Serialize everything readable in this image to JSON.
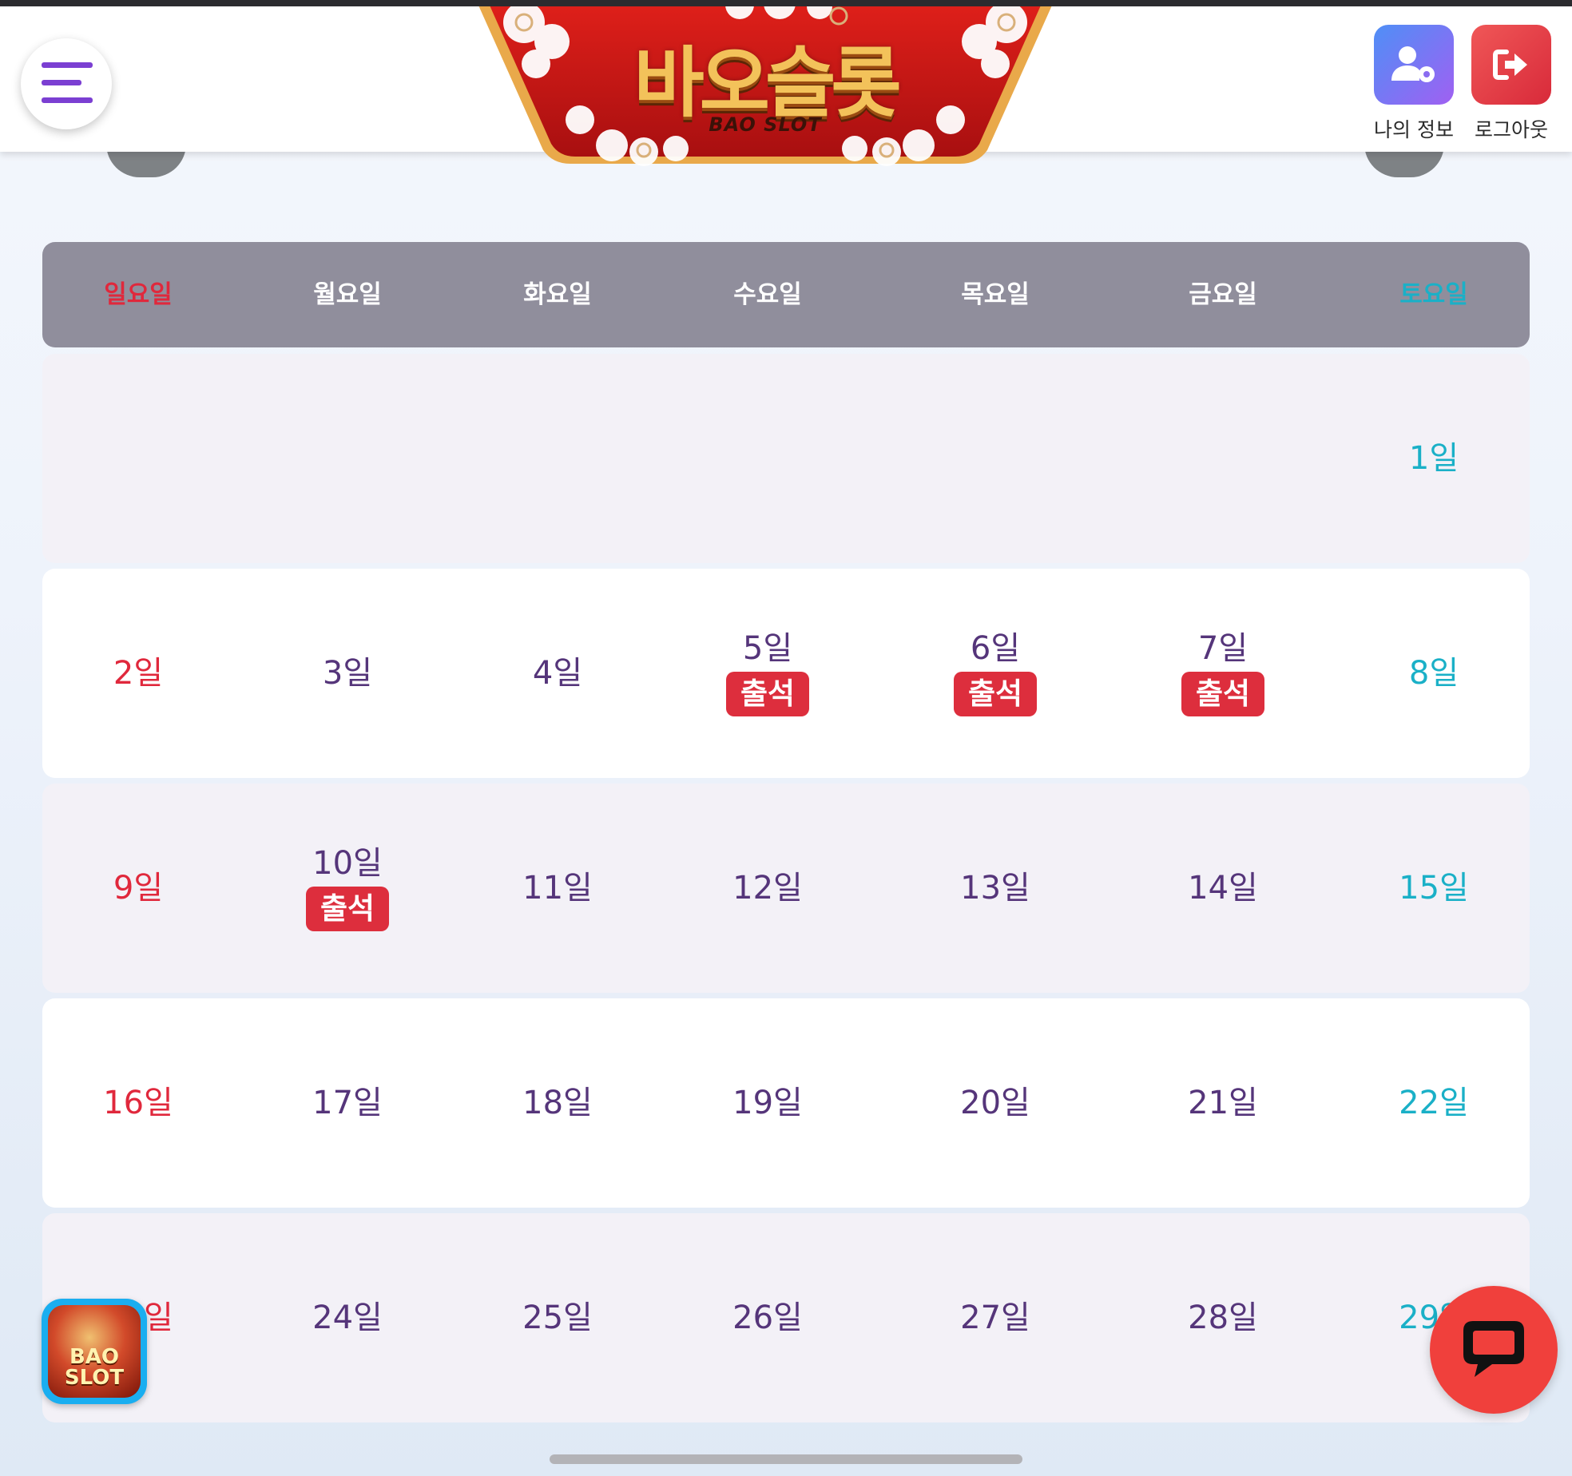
{
  "header": {
    "logo_title": "바오슬롯",
    "logo_subtitle": "BAO SLOT",
    "menu_icon": "hamburger-icon",
    "actions": [
      {
        "label": "나의 정보",
        "icon": "user-settings-icon",
        "color": "#7a6cf4"
      },
      {
        "label": "로그아웃",
        "icon": "logout-icon",
        "color": "#e3343e"
      }
    ]
  },
  "calendar": {
    "weekdays": [
      "일요일",
      "월요일",
      "화요일",
      "수요일",
      "목요일",
      "금요일",
      "토요일"
    ],
    "attendance_label": "출석",
    "weeks": [
      [
        null,
        null,
        null,
        null,
        null,
        null,
        {
          "day": "1일"
        }
      ],
      [
        {
          "day": "2일"
        },
        {
          "day": "3일"
        },
        {
          "day": "4일"
        },
        {
          "day": "5일",
          "attended": true
        },
        {
          "day": "6일",
          "attended": true
        },
        {
          "day": "7일",
          "attended": true
        },
        {
          "day": "8일"
        }
      ],
      [
        {
          "day": "9일"
        },
        {
          "day": "10일",
          "attended": true
        },
        {
          "day": "11일"
        },
        {
          "day": "12일"
        },
        {
          "day": "13일"
        },
        {
          "day": "14일"
        },
        {
          "day": "15일"
        }
      ],
      [
        {
          "day": "16일"
        },
        {
          "day": "17일"
        },
        {
          "day": "18일"
        },
        {
          "day": "19일"
        },
        {
          "day": "20일"
        },
        {
          "day": "21일"
        },
        {
          "day": "22일"
        }
      ],
      [
        {
          "day": "23일"
        },
        {
          "day": "24일"
        },
        {
          "day": "25일"
        },
        {
          "day": "26일"
        },
        {
          "day": "27일"
        },
        {
          "day": "28일"
        },
        {
          "day": "29일"
        }
      ]
    ]
  },
  "floating": {
    "app_icon_text": "BAO SLOT",
    "chat_icon": "chat-bubble-icon"
  },
  "colors": {
    "sunday": "#e0283c",
    "saturday": "#1ab0c7",
    "weekday": "#55357a",
    "badge": "#dd2e3d",
    "header_row": "#908e9c"
  }
}
